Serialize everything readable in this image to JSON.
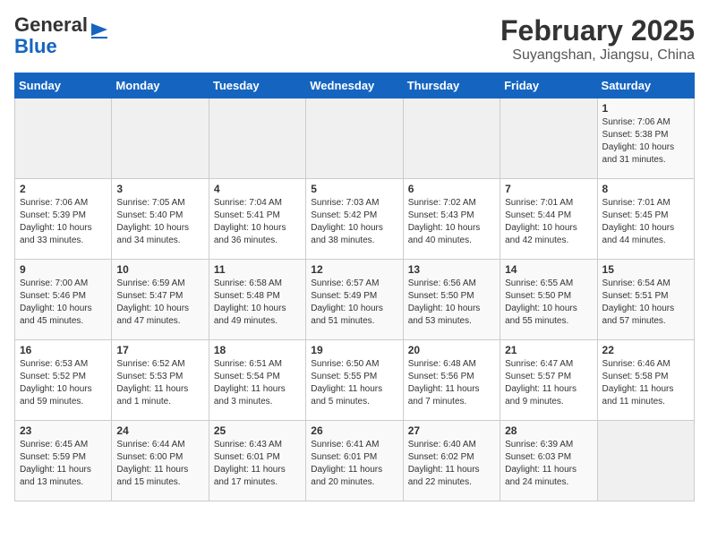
{
  "header": {
    "logo_general": "General",
    "logo_blue": "Blue",
    "title": "February 2025",
    "subtitle": "Suyangshan, Jiangsu, China"
  },
  "days_of_week": [
    "Sunday",
    "Monday",
    "Tuesday",
    "Wednesday",
    "Thursday",
    "Friday",
    "Saturday"
  ],
  "weeks": [
    [
      {
        "day": "",
        "info": ""
      },
      {
        "day": "",
        "info": ""
      },
      {
        "day": "",
        "info": ""
      },
      {
        "day": "",
        "info": ""
      },
      {
        "day": "",
        "info": ""
      },
      {
        "day": "",
        "info": ""
      },
      {
        "day": "1",
        "info": "Sunrise: 7:06 AM\nSunset: 5:38 PM\nDaylight: 10 hours\nand 31 minutes."
      }
    ],
    [
      {
        "day": "2",
        "info": "Sunrise: 7:06 AM\nSunset: 5:39 PM\nDaylight: 10 hours\nand 33 minutes."
      },
      {
        "day": "3",
        "info": "Sunrise: 7:05 AM\nSunset: 5:40 PM\nDaylight: 10 hours\nand 34 minutes."
      },
      {
        "day": "4",
        "info": "Sunrise: 7:04 AM\nSunset: 5:41 PM\nDaylight: 10 hours\nand 36 minutes."
      },
      {
        "day": "5",
        "info": "Sunrise: 7:03 AM\nSunset: 5:42 PM\nDaylight: 10 hours\nand 38 minutes."
      },
      {
        "day": "6",
        "info": "Sunrise: 7:02 AM\nSunset: 5:43 PM\nDaylight: 10 hours\nand 40 minutes."
      },
      {
        "day": "7",
        "info": "Sunrise: 7:01 AM\nSunset: 5:44 PM\nDaylight: 10 hours\nand 42 minutes."
      },
      {
        "day": "8",
        "info": "Sunrise: 7:01 AM\nSunset: 5:45 PM\nDaylight: 10 hours\nand 44 minutes."
      }
    ],
    [
      {
        "day": "9",
        "info": "Sunrise: 7:00 AM\nSunset: 5:46 PM\nDaylight: 10 hours\nand 45 minutes."
      },
      {
        "day": "10",
        "info": "Sunrise: 6:59 AM\nSunset: 5:47 PM\nDaylight: 10 hours\nand 47 minutes."
      },
      {
        "day": "11",
        "info": "Sunrise: 6:58 AM\nSunset: 5:48 PM\nDaylight: 10 hours\nand 49 minutes."
      },
      {
        "day": "12",
        "info": "Sunrise: 6:57 AM\nSunset: 5:49 PM\nDaylight: 10 hours\nand 51 minutes."
      },
      {
        "day": "13",
        "info": "Sunrise: 6:56 AM\nSunset: 5:50 PM\nDaylight: 10 hours\nand 53 minutes."
      },
      {
        "day": "14",
        "info": "Sunrise: 6:55 AM\nSunset: 5:50 PM\nDaylight: 10 hours\nand 55 minutes."
      },
      {
        "day": "15",
        "info": "Sunrise: 6:54 AM\nSunset: 5:51 PM\nDaylight: 10 hours\nand 57 minutes."
      }
    ],
    [
      {
        "day": "16",
        "info": "Sunrise: 6:53 AM\nSunset: 5:52 PM\nDaylight: 10 hours\nand 59 minutes."
      },
      {
        "day": "17",
        "info": "Sunrise: 6:52 AM\nSunset: 5:53 PM\nDaylight: 11 hours\nand 1 minute."
      },
      {
        "day": "18",
        "info": "Sunrise: 6:51 AM\nSunset: 5:54 PM\nDaylight: 11 hours\nand 3 minutes."
      },
      {
        "day": "19",
        "info": "Sunrise: 6:50 AM\nSunset: 5:55 PM\nDaylight: 11 hours\nand 5 minutes."
      },
      {
        "day": "20",
        "info": "Sunrise: 6:48 AM\nSunset: 5:56 PM\nDaylight: 11 hours\nand 7 minutes."
      },
      {
        "day": "21",
        "info": "Sunrise: 6:47 AM\nSunset: 5:57 PM\nDaylight: 11 hours\nand 9 minutes."
      },
      {
        "day": "22",
        "info": "Sunrise: 6:46 AM\nSunset: 5:58 PM\nDaylight: 11 hours\nand 11 minutes."
      }
    ],
    [
      {
        "day": "23",
        "info": "Sunrise: 6:45 AM\nSunset: 5:59 PM\nDaylight: 11 hours\nand 13 minutes."
      },
      {
        "day": "24",
        "info": "Sunrise: 6:44 AM\nSunset: 6:00 PM\nDaylight: 11 hours\nand 15 minutes."
      },
      {
        "day": "25",
        "info": "Sunrise: 6:43 AM\nSunset: 6:01 PM\nDaylight: 11 hours\nand 17 minutes."
      },
      {
        "day": "26",
        "info": "Sunrise: 6:41 AM\nSunset: 6:01 PM\nDaylight: 11 hours\nand 20 minutes."
      },
      {
        "day": "27",
        "info": "Sunrise: 6:40 AM\nSunset: 6:02 PM\nDaylight: 11 hours\nand 22 minutes."
      },
      {
        "day": "28",
        "info": "Sunrise: 6:39 AM\nSunset: 6:03 PM\nDaylight: 11 hours\nand 24 minutes."
      },
      {
        "day": "",
        "info": ""
      }
    ]
  ]
}
